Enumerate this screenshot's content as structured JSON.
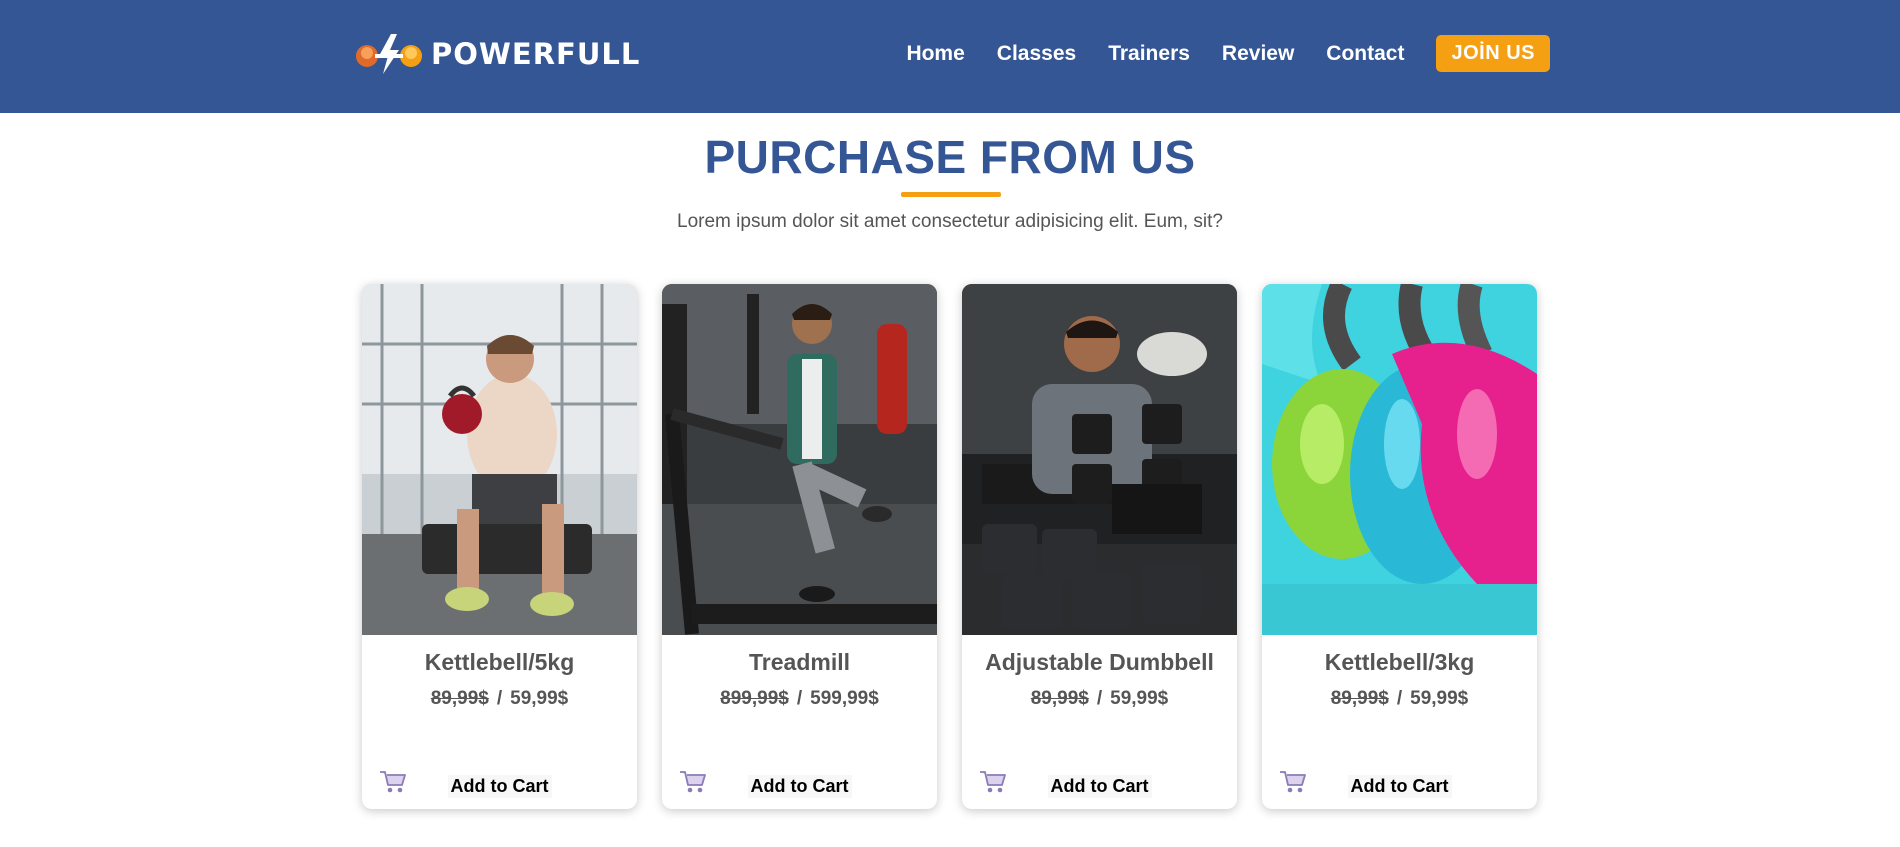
{
  "header": {
    "brand": "POWERFULL",
    "nav": [
      "Home",
      "Classes",
      "Trainers",
      "Review",
      "Contact"
    ],
    "join_label": "JOİN US"
  },
  "section": {
    "title": "PURCHASE FROM US",
    "subtitle": "Lorem ipsum dolor sit amet consectetur adipisicing elit. Eum, sit?"
  },
  "products": [
    {
      "name": "Kettlebell/5kg",
      "old_price": "89,99$",
      "separator": "/",
      "new_price": "59,99$",
      "cart_label": "Add to Cart"
    },
    {
      "name": "Treadmill",
      "old_price": "899,99$",
      "separator": "/",
      "new_price": "599,99$",
      "cart_label": "Add to Cart"
    },
    {
      "name": "Adjustable Dumbbell",
      "old_price": "89,99$",
      "separator": "/",
      "new_price": "59,99$",
      "cart_label": "Add to Cart"
    },
    {
      "name": "Kettlebell/3kg",
      "old_price": "89,99$",
      "separator": "/",
      "new_price": "59,99$",
      "cart_label": "Add to Cart"
    }
  ],
  "colors": {
    "navbar": "#355694",
    "accent": "#f5a012",
    "title": "#355694"
  },
  "icons": [
    "brand-logo-icon",
    "cart-icon"
  ]
}
